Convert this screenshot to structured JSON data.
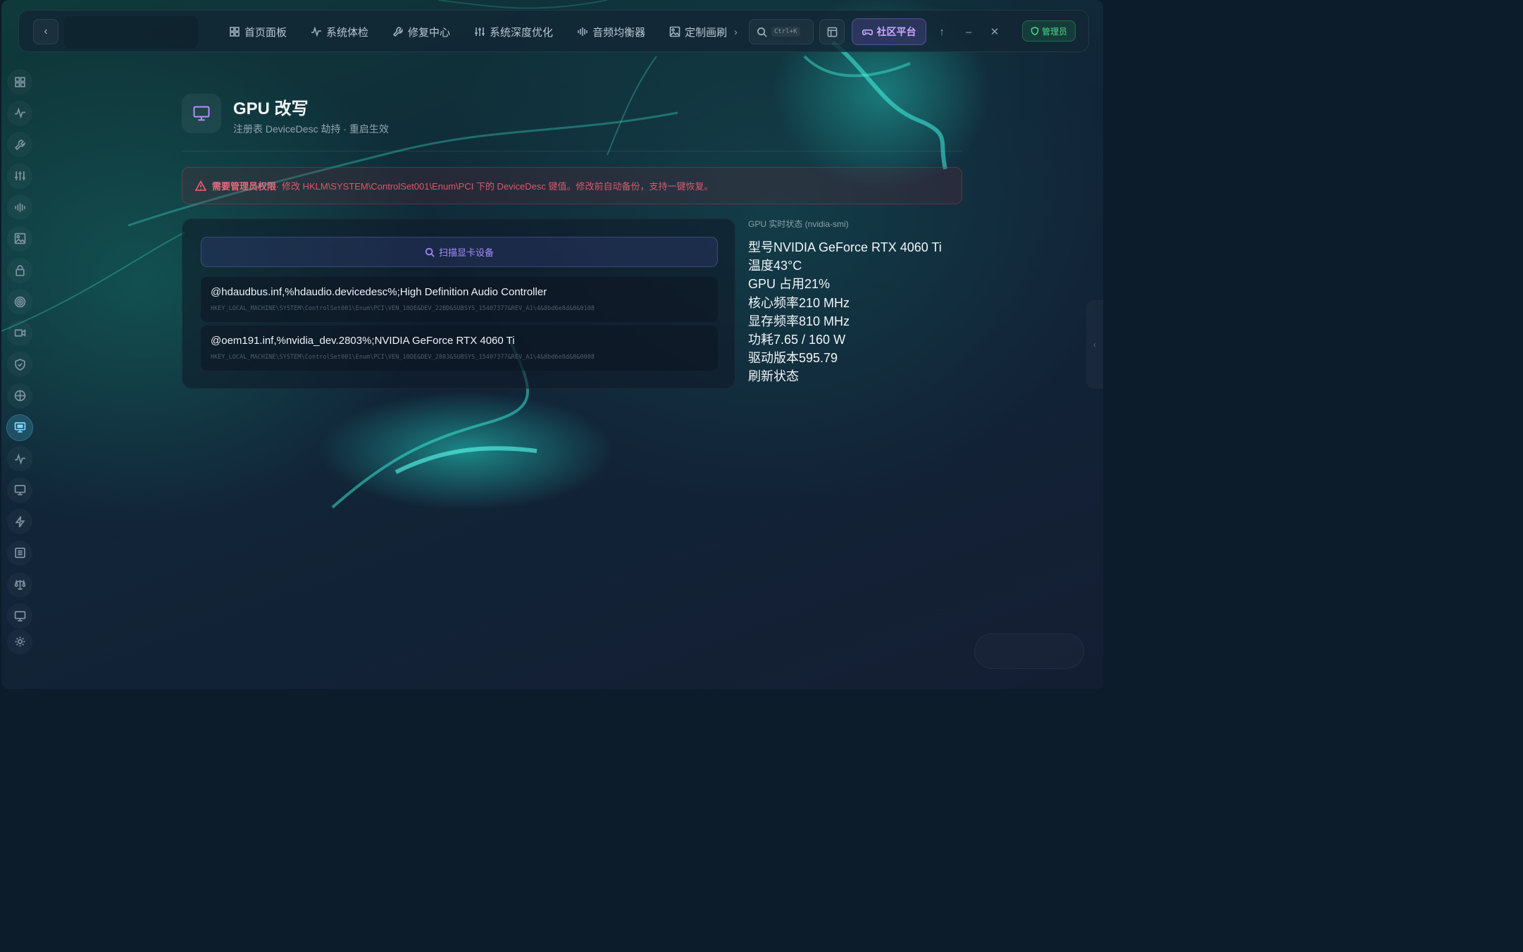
{
  "topbar": {
    "nav": [
      {
        "label": "首页面板",
        "icon": "grid-icon"
      },
      {
        "label": "系统体检",
        "icon": "pulse-icon"
      },
      {
        "label": "修复中心",
        "icon": "wrench-icon"
      },
      {
        "label": "系统深度优化",
        "icon": "sliders-icon"
      },
      {
        "label": "音频均衡器",
        "icon": "equalizer-icon"
      },
      {
        "label": "定制画刷",
        "icon": "image-icon"
      }
    ],
    "search_shortcut": "Ctrl+K",
    "community_label": "社区平台",
    "admin_label": "管理员"
  },
  "sidebar": {
    "items": [
      {
        "icon": "grid-icon"
      },
      {
        "icon": "pulse-icon"
      },
      {
        "icon": "wrench-icon"
      },
      {
        "icon": "sliders-icon"
      },
      {
        "icon": "equalizer-icon"
      },
      {
        "icon": "image-icon"
      },
      {
        "icon": "lock-icon"
      },
      {
        "icon": "target-icon"
      },
      {
        "icon": "camera-icon"
      },
      {
        "icon": "shield-icon"
      },
      {
        "icon": "globe-icon"
      },
      {
        "icon": "monitor-icon",
        "active": true
      },
      {
        "icon": "activity-icon"
      },
      {
        "icon": "display-icon"
      },
      {
        "icon": "bolt-icon"
      },
      {
        "icon": "list-icon"
      },
      {
        "icon": "scale-icon"
      },
      {
        "icon": "screen-icon"
      },
      {
        "icon": "settings-icon"
      }
    ]
  },
  "page": {
    "title": "GPU 改写",
    "subtitle": "注册表 DeviceDesc 劫持 · 重启生效"
  },
  "warning": {
    "bold": "需要管理员权限",
    "text": "· 修改 HKLM\\SYSTEM\\ControlSet001\\Enum\\PCI 下的 DeviceDesc 键值。修改前自动备份，支持一键恢复。"
  },
  "devices": {
    "scan_label": "扫描显卡设备",
    "items": [
      {
        "name": "@hdaudbus.inf,%hdaudio.devicedesc%;High Definition Audio Controller",
        "path": "HKEY_LOCAL_MACHINE\\SYSTEM\\ControlSet001\\Enum\\PCI\\VEN_10DE&DEV_22BD&SUBSYS_15407377&REV_A1\\4&8bd6e8d&0&0108"
      },
      {
        "name": "@oem191.inf,%nvidia_dev.2803%;NVIDIA GeForce RTX 4060 Ti",
        "path": "HKEY_LOCAL_MACHINE\\SYSTEM\\ControlSet001\\Enum\\PCI\\VEN_10DE&DEV_2803&SUBSYS_15407377&REV_A1\\4&8bd6e8d&0&0008"
      }
    ]
  },
  "status": {
    "title": "GPU 实时状态 (nvidia-smi)",
    "lines": [
      "型号NVIDIA GeForce RTX 4060 Ti",
      "温度43°C",
      "GPU 占用21%",
      "核心频率210 MHz",
      "显存频率810 MHz",
      "功耗7.65 / 160 W",
      "驱动版本595.79",
      "刷新状态"
    ]
  },
  "colors": {
    "accent_purple": "#a78bfa",
    "admin_green": "#4fd68a",
    "warning_red": "#d65a6e",
    "active_blue": "#7fd6ff"
  }
}
